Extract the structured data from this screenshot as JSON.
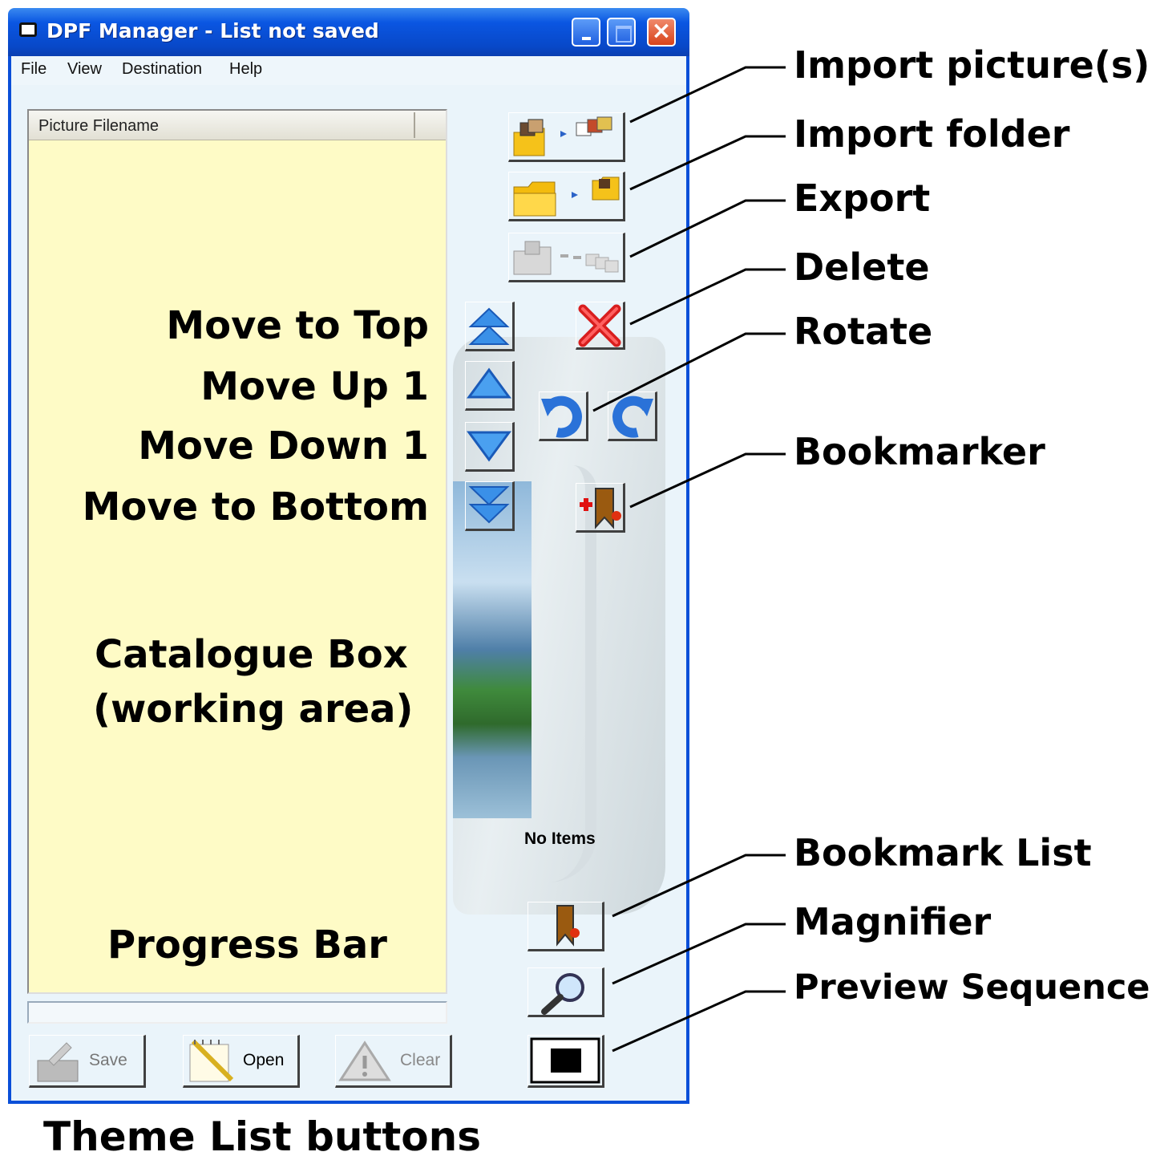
{
  "window": {
    "title": "DPF Manager - List not saved",
    "close_glyph": "×"
  },
  "menu": {
    "items": [
      "File",
      "View",
      "Destination",
      "Help"
    ]
  },
  "catalogue": {
    "column_header": "Picture Filename",
    "status": "No Items"
  },
  "theme_list": {
    "save_label": "Save",
    "open_label": "Open",
    "clear_label": "Clear"
  },
  "icons": {
    "import_pictures": "import-pictures-icon",
    "import_folder": "import-folder-icon",
    "export": "export-icon",
    "delete": "delete-icon",
    "rotate_left": "rotate-left-icon",
    "rotate_right": "rotate-right-icon",
    "bookmarker": "bookmarker-icon",
    "bookmark_list": "bookmark-list-icon",
    "magnifier": "magnifier-icon",
    "preview_sequence": "preview-sequence-icon",
    "move_top": "move-to-top-icon",
    "move_up": "move-up-icon",
    "move_down": "move-down-icon",
    "move_bottom": "move-to-bottom-icon"
  },
  "annotations": {
    "right": {
      "import_pictures": "Import picture(s)",
      "import_folder": "Import folder",
      "export": "Export",
      "delete": "Delete",
      "rotate": "Rotate",
      "bookmarker": "Bookmarker",
      "bookmark_list": "Bookmark List",
      "magnifier": "Magnifier",
      "preview_sequence": "Preview Sequence"
    },
    "left": {
      "move_top": "Move to Top",
      "move_up": "Move Up 1",
      "move_down": "Move Down 1",
      "move_bottom": "Move to Bottom",
      "catalogue_line1": "Catalogue Box",
      "catalogue_line2": "(working area)",
      "progress": "Progress Bar"
    },
    "bottom": "Theme List buttons"
  },
  "colors": {
    "titlebar": "#0a56e2",
    "catalogue_bg": "#fefbc6",
    "window_bg": "#eaf4fa"
  }
}
